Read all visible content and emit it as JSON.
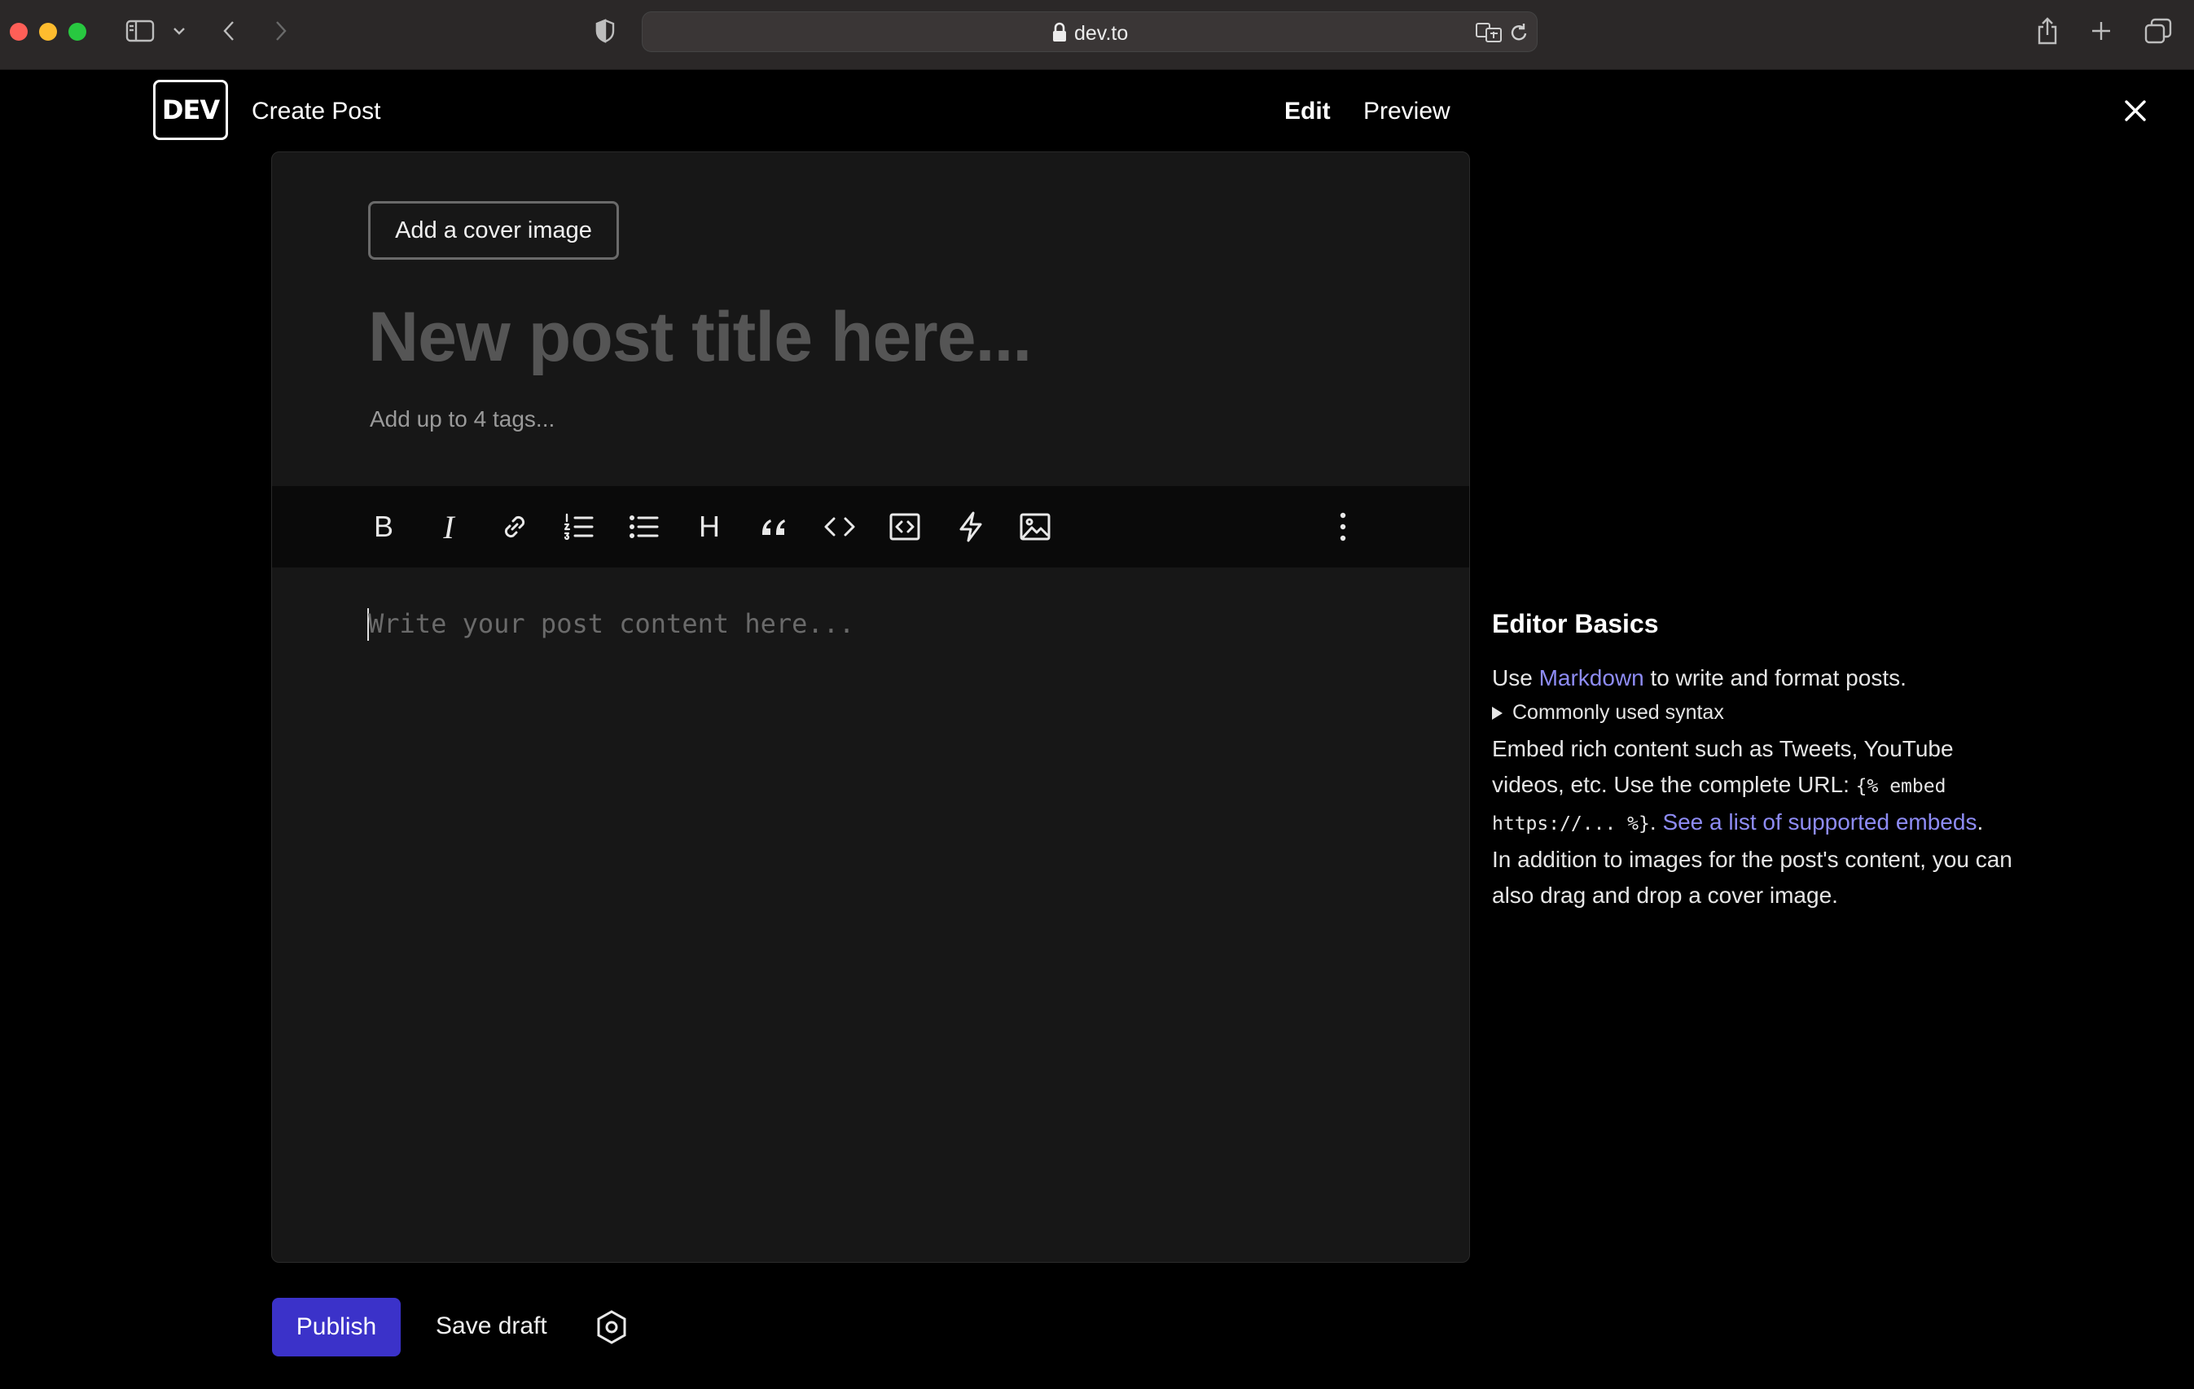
{
  "browser": {
    "url": "dev.to"
  },
  "header": {
    "logo_text": "DEV",
    "title": "Create Post",
    "tabs": [
      {
        "label": "Edit",
        "active": true
      },
      {
        "label": "Preview",
        "active": false
      }
    ]
  },
  "editor": {
    "cover_button_label": "Add a cover image",
    "title_placeholder": "New post title here...",
    "tags_placeholder": "Add up to 4 tags...",
    "body_placeholder": "Write your post content here...",
    "toolbar": {
      "bold": "B",
      "italic": "I",
      "heading": "H",
      "tools": [
        "bold-icon",
        "italic-icon",
        "link-icon",
        "ordered-list-icon",
        "unordered-list-icon",
        "heading-icon",
        "quote-icon",
        "code-icon",
        "code-block-icon",
        "lightning-icon",
        "image-icon",
        "more-options-icon"
      ]
    }
  },
  "help": {
    "heading": "Editor Basics",
    "p1_before": "Use ",
    "p1_link": "Markdown",
    "p1_after": " to write and format posts.",
    "summary": "Commonly used syntax",
    "p2_text": "Embed rich content such as Tweets, YouTube videos, etc. Use the complete URL: ",
    "p2_code": "{% embed https://... %}",
    "p2_dot": ". ",
    "p2_link": "See a list of supported embeds",
    "p2_end": ".",
    "p3": "In addition to images for the post's content, you can also drag and drop a cover image."
  },
  "footer": {
    "publish_label": "Publish",
    "save_draft_label": "Save draft"
  },
  "colors": {
    "accent": "#3b32c9",
    "link": "#8e8cf5",
    "background": "#000000",
    "card": "#171717"
  }
}
